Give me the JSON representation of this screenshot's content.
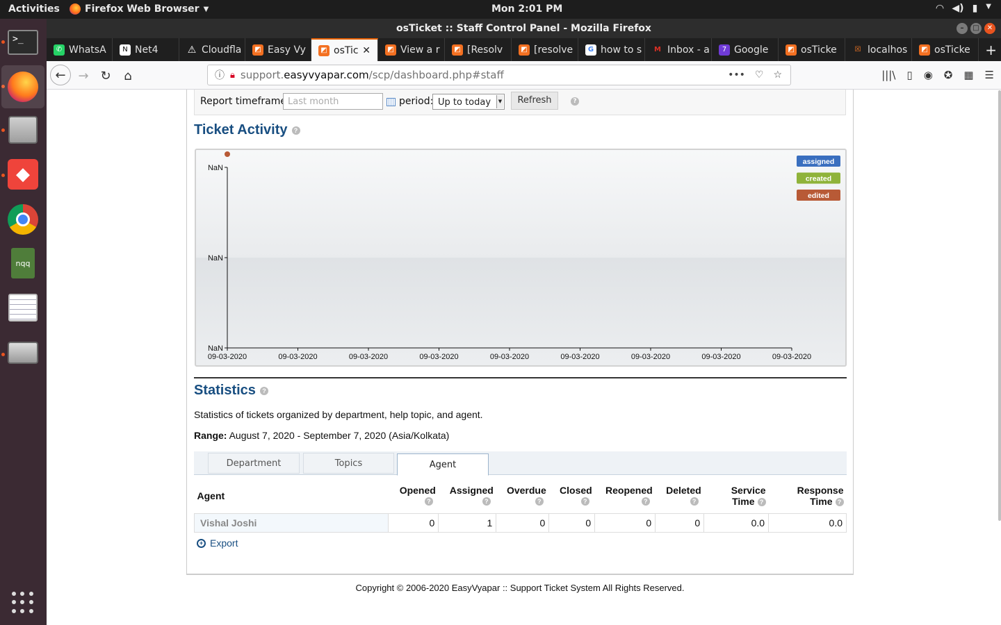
{
  "system": {
    "activities": "Activities",
    "app_name": "Firefox Web Browser",
    "clock": "Mon  2:01 PM"
  },
  "window": {
    "title": "osTicket :: Staff Control Panel - Mozilla Firefox"
  },
  "tabs": [
    {
      "label": "WhatsA",
      "icon": "whatsapp-icon"
    },
    {
      "label": "Net4",
      "icon": "net4-icon"
    },
    {
      "label": "Cloudfla",
      "icon": "warning-icon"
    },
    {
      "label": "Easy Vy",
      "icon": "osticket-icon"
    },
    {
      "label": "osTic",
      "icon": "osticket-icon",
      "active": true
    },
    {
      "label": "View a r",
      "icon": "osticket-icon"
    },
    {
      "label": "[Resolv",
      "icon": "osticket-icon"
    },
    {
      "label": "[resolve",
      "icon": "osticket-icon"
    },
    {
      "label": "how to s",
      "icon": "google-icon"
    },
    {
      "label": "Inbox - a",
      "icon": "gmail-icon"
    },
    {
      "label": "Google",
      "icon": "calendar-icon"
    },
    {
      "label": "osTicke",
      "icon": "osticket-icon"
    },
    {
      "label": "localhos",
      "icon": "xampp-icon"
    },
    {
      "label": "osTicke",
      "icon": "osticket-icon"
    }
  ],
  "address": {
    "url_prefix": "support.",
    "url_domain": "easyvyapar.com",
    "url_path": "/scp/dashboard.php#staff"
  },
  "filter": {
    "timeframe_label": "Report timeframe:",
    "timeframe_placeholder": "Last month",
    "period_label": "period:",
    "period_value": "Up to today",
    "refresh_label": "Refresh"
  },
  "activity": {
    "heading": "Ticket Activity"
  },
  "chart_data": {
    "type": "line",
    "x": [
      "09-03-2020",
      "09-03-2020",
      "09-03-2020",
      "09-03-2020",
      "09-03-2020",
      "09-03-2020",
      "09-03-2020",
      "09-03-2020",
      "09-03-2020"
    ],
    "y_ticks": [
      "NaN",
      "NaN",
      "NaN"
    ],
    "series": [
      {
        "name": "assigned",
        "color": "#3a6fbf",
        "values": []
      },
      {
        "name": "created",
        "color": "#8fb33a",
        "values": []
      },
      {
        "name": "edited",
        "color": "#b85a36",
        "values": []
      }
    ],
    "legend_position": "top-right",
    "grid": false
  },
  "statistics": {
    "heading": "Statistics",
    "description": "Statistics of tickets organized by department, help topic, and agent.",
    "range_label": "Range:",
    "range_value": "August 7, 2020 - September 7, 2020 (Asia/Kolkata)",
    "tabs": [
      "Department",
      "Topics",
      "Agent"
    ],
    "columns": [
      {
        "line1": "Agent",
        "line2": ""
      },
      {
        "line1": "Opened",
        "line2": ""
      },
      {
        "line1": "Assigned",
        "line2": ""
      },
      {
        "line1": "Overdue",
        "line2": ""
      },
      {
        "line1": "Closed",
        "line2": ""
      },
      {
        "line1": "Reopened",
        "line2": ""
      },
      {
        "line1": "Deleted",
        "line2": ""
      },
      {
        "line1": "Service",
        "line2": "Time"
      },
      {
        "line1": "Response",
        "line2": "Time"
      }
    ],
    "rows": [
      {
        "agent": "Vishal Joshi",
        "opened": "0",
        "assigned": "1",
        "overdue": "0",
        "closed": "0",
        "reopened": "0",
        "deleted": "0",
        "service_time": "0.0",
        "response_time": "0.0"
      }
    ],
    "export_label": "Export"
  },
  "footer": {
    "copyright": "Copyright © 2006-2020 EasyVyapar :: Support Ticket System All Rights Reserved."
  }
}
